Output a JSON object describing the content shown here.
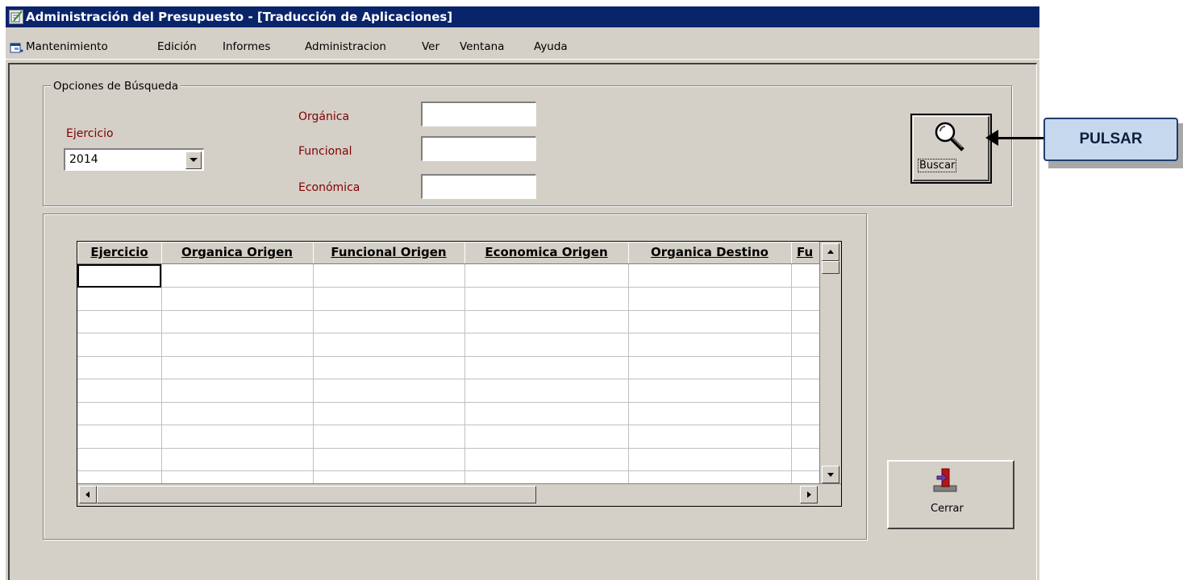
{
  "window": {
    "title": "Administración del Presupuesto - [Traducción de Aplicaciones]"
  },
  "menu": {
    "items": [
      "Mantenimiento",
      "Edición",
      "Informes",
      "Administracion",
      "Ver",
      "Ventana",
      "Ayuda"
    ]
  },
  "search": {
    "legend": "Opciones de Búsqueda",
    "ejercicio_label": "Ejercicio",
    "ejercicio_value": "2014",
    "organica_label": "Orgánica",
    "organica_value": "",
    "funcional_label": "Funcional",
    "funcional_value": "",
    "economica_label": "Económica",
    "economica_value": "",
    "buscar_label": "Buscar"
  },
  "grid": {
    "columns": [
      "Ejercicio",
      "Organica Origen",
      "Funcional Origen",
      "Economica Origen",
      "Organica Destino",
      "Fu"
    ],
    "rows": []
  },
  "buttons": {
    "cerrar_label": "Cerrar"
  },
  "callout": {
    "text": "PULSAR"
  },
  "colors": {
    "titlebar": "#0a246a",
    "label_red": "#800000",
    "window_bg": "#d4d0c8",
    "callout_bg": "#c6d8ee"
  }
}
